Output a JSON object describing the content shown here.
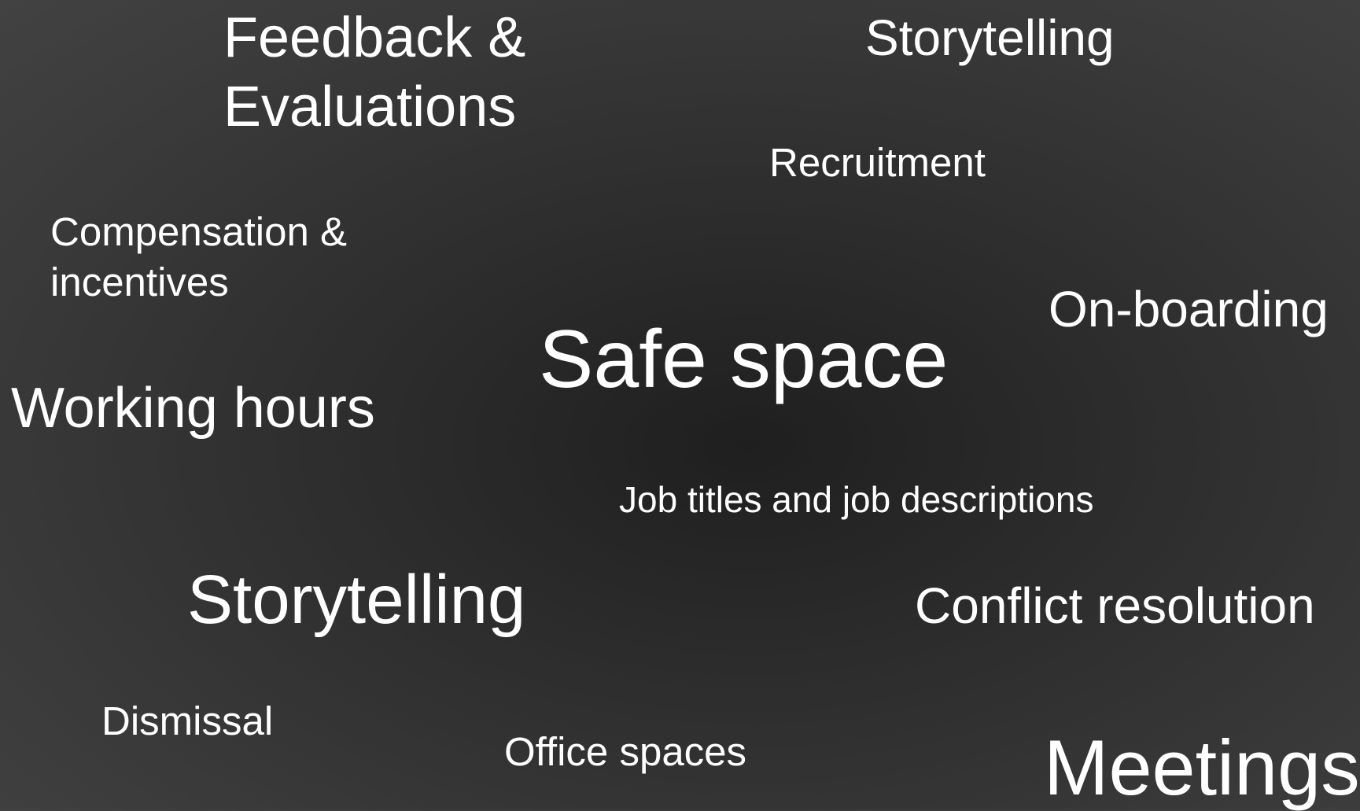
{
  "words": {
    "feedback_line1": "Feedback &",
    "feedback_line2": "Evaluations",
    "storytelling_top": "Storytelling",
    "recruitment": "Recruitment",
    "compensation_line1": "Compensation &",
    "compensation_line2": "incentives",
    "onboarding": "On-boarding",
    "safe_space": "Safe space",
    "working_hours": "Working hours",
    "job_titles": "Job titles and job descriptions",
    "storytelling_mid": "Storytelling",
    "conflict_resolution": "Conflict resolution",
    "dismissal": "Dismissal",
    "office_spaces": "Office spaces",
    "meetings": "Meetings"
  },
  "colors": {
    "text": "#ffffff",
    "background_center": "#1f1f1f",
    "background_edge": "#424242"
  }
}
